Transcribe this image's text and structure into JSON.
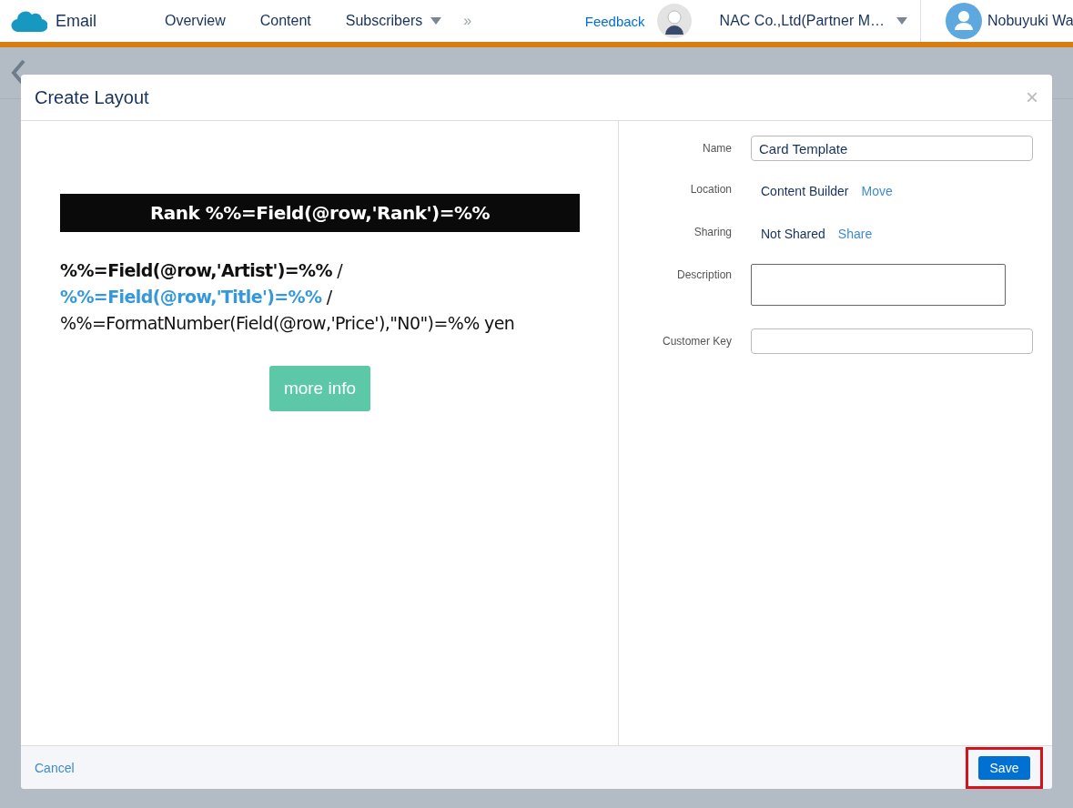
{
  "nav": {
    "app_name": "Email",
    "tabs": [
      {
        "label": "Overview",
        "dropdown": false
      },
      {
        "label": "Content",
        "dropdown": false
      },
      {
        "label": "Subscribers",
        "dropdown": true
      }
    ],
    "more": "»",
    "feedback": "Feedback",
    "account": "NAC Co.,Ltd(Partner M…",
    "user": "Nobuyuki Wa"
  },
  "dialog": {
    "title": "Create Layout",
    "close": "×",
    "preview": {
      "banner": "Rank %%=Field(@row,'Rank')=%%",
      "lines": [
        "**%%=Field(@row,'Artist')=%%** /",
        "**%%=Field(@row,'Title')=%%** /",
        "%%=FormatNumber(Field(@row,'Price'),\"N0\")=%% yen"
      ],
      "button": "more info"
    },
    "fields": [
      {
        "label": "Name",
        "kind": "input",
        "value": "Card Template"
      },
      {
        "label": "Location",
        "kind": "text",
        "value": "Content Builder",
        "link": "Move"
      },
      {
        "label": "Sharing",
        "kind": "text",
        "value": "Not Shared",
        "link": "Share"
      },
      {
        "label": "Description",
        "kind": "textarea"
      },
      {
        "label": "Customer Key",
        "kind": "input"
      }
    ],
    "cancel": "Cancel",
    "save": "Save",
    "save_highlighted": true
  }
}
